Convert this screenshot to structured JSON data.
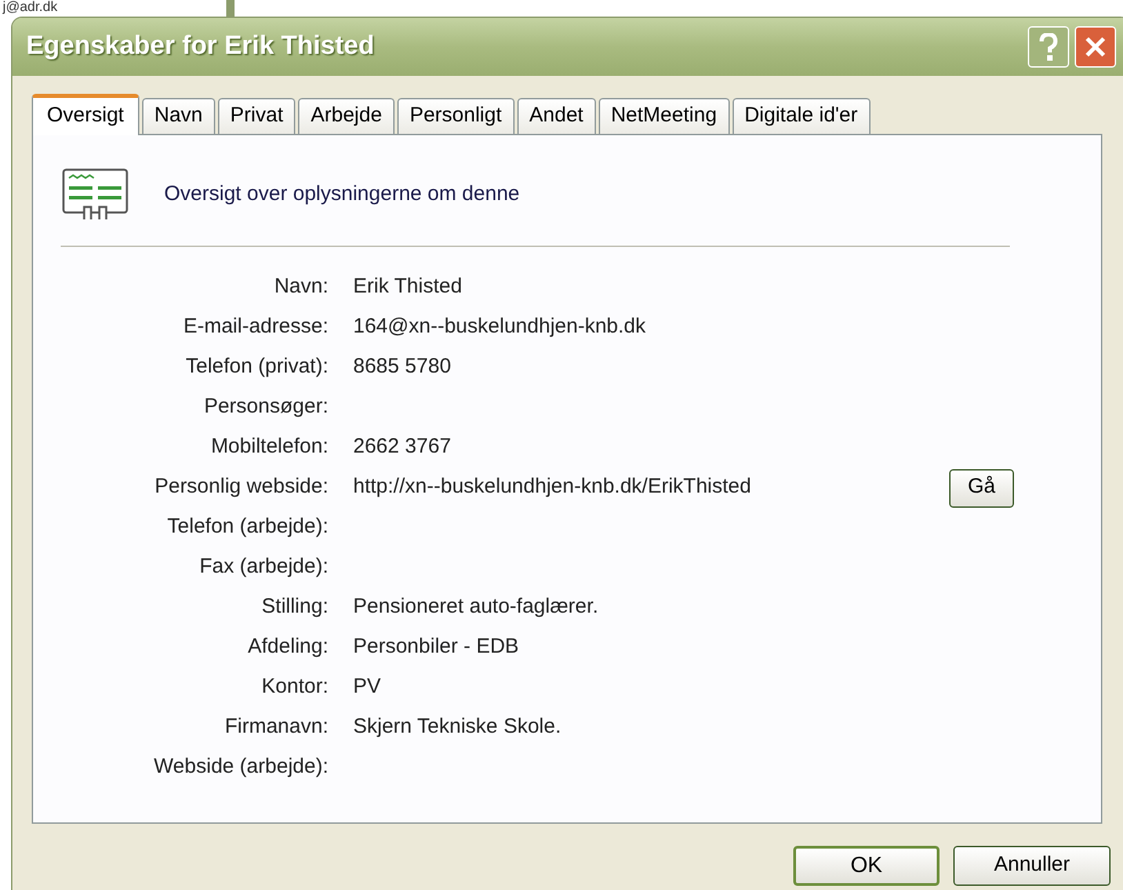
{
  "background_window": {
    "text": "j@adr.dk"
  },
  "window": {
    "title": "Egenskaber for Erik Thisted"
  },
  "tabs": [
    {
      "label": "Oversigt",
      "selected": true
    },
    {
      "label": "Navn",
      "selected": false
    },
    {
      "label": "Privat",
      "selected": false
    },
    {
      "label": "Arbejde",
      "selected": false
    },
    {
      "label": "Personligt",
      "selected": false
    },
    {
      "label": "Andet",
      "selected": false
    },
    {
      "label": "NetMeeting",
      "selected": false
    },
    {
      "label": "Digitale id'er",
      "selected": false
    }
  ],
  "header": "Oversigt over oplysningerne om denne",
  "fields": [
    {
      "label": "Navn:",
      "value": "Erik Thisted"
    },
    {
      "label": "E-mail-adresse:",
      "value": "164@xn--buskelundhjen-knb.dk"
    },
    {
      "label": "Telefon (privat):",
      "value": "8685 5780"
    },
    {
      "label": "Personsøger:"
    },
    {
      "label": "Mobiltelefon:",
      "value": "2662 3767"
    },
    {
      "label": "Personlig webside:",
      "value": "http://xn--buskelundhjen-knb.dk/ErikThisted",
      "button": "Gå"
    },
    {
      "label": "Telefon (arbejde):"
    },
    {
      "label": "Fax (arbejde):"
    },
    {
      "label": "Stilling:",
      "value": "Pensioneret auto-faglærer."
    },
    {
      "label": "Afdeling:",
      "value": "Personbiler - EDB"
    },
    {
      "label": "Kontor:",
      "value": "PV"
    },
    {
      "label": "Firmanavn:",
      "value": "Skjern Tekniske Skole."
    },
    {
      "label": "Webside (arbejde):"
    }
  ],
  "buttons": [
    "OK",
    "Annuller"
  ]
}
